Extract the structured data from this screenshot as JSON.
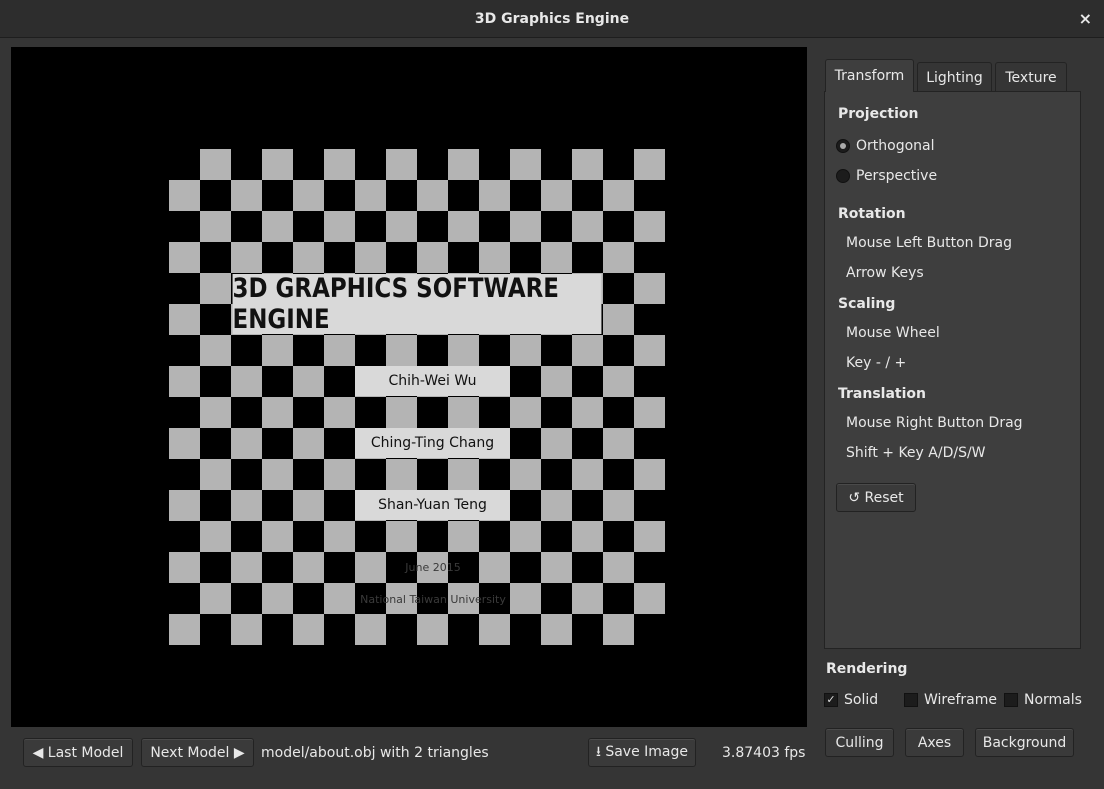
{
  "window": {
    "title": "3D Graphics Engine",
    "close_icon": "×"
  },
  "viewport": {
    "title": "3D GRAPHICS SOFTWARE ENGINE",
    "authors": [
      "Chih-Wei Wu",
      "Ching-Ting Chang",
      "Shan-Yuan Teng"
    ],
    "date": "June 2015",
    "institution": "National Taiwan University"
  },
  "bottom": {
    "last_model": "◀ Last Model",
    "next_model": "Next Model ▶",
    "status": "model/about.obj with 2 triangles",
    "save_image": "⭳ Save Image",
    "fps": "3.87403 fps"
  },
  "tabs": [
    {
      "label": "Transform",
      "active": true
    },
    {
      "label": "Lighting"
    },
    {
      "label": "Texture"
    }
  ],
  "transform": {
    "projection": {
      "label": "Projection",
      "options": [
        {
          "label": "Orthogonal",
          "selected": true
        },
        {
          "label": "Perspective",
          "selected": false
        }
      ]
    },
    "rotation": {
      "label": "Rotation",
      "items": [
        "Mouse Left Button Drag",
        "Arrow Keys"
      ]
    },
    "scaling": {
      "label": "Scaling",
      "items": [
        "Mouse Wheel",
        "Key - / +"
      ]
    },
    "translation": {
      "label": "Translation",
      "items": [
        "Mouse Right Button Drag",
        "Shift + Key A/D/S/W"
      ]
    },
    "reset": "↺ Reset"
  },
  "rendering": {
    "label": "Rendering",
    "checks": [
      {
        "label": "Solid",
        "checked": true,
        "mark": "✓"
      },
      {
        "label": "Wireframe",
        "checked": false
      },
      {
        "label": "Normals",
        "checked": false
      }
    ],
    "buttons": [
      "Culling",
      "Axes",
      "Background"
    ]
  }
}
